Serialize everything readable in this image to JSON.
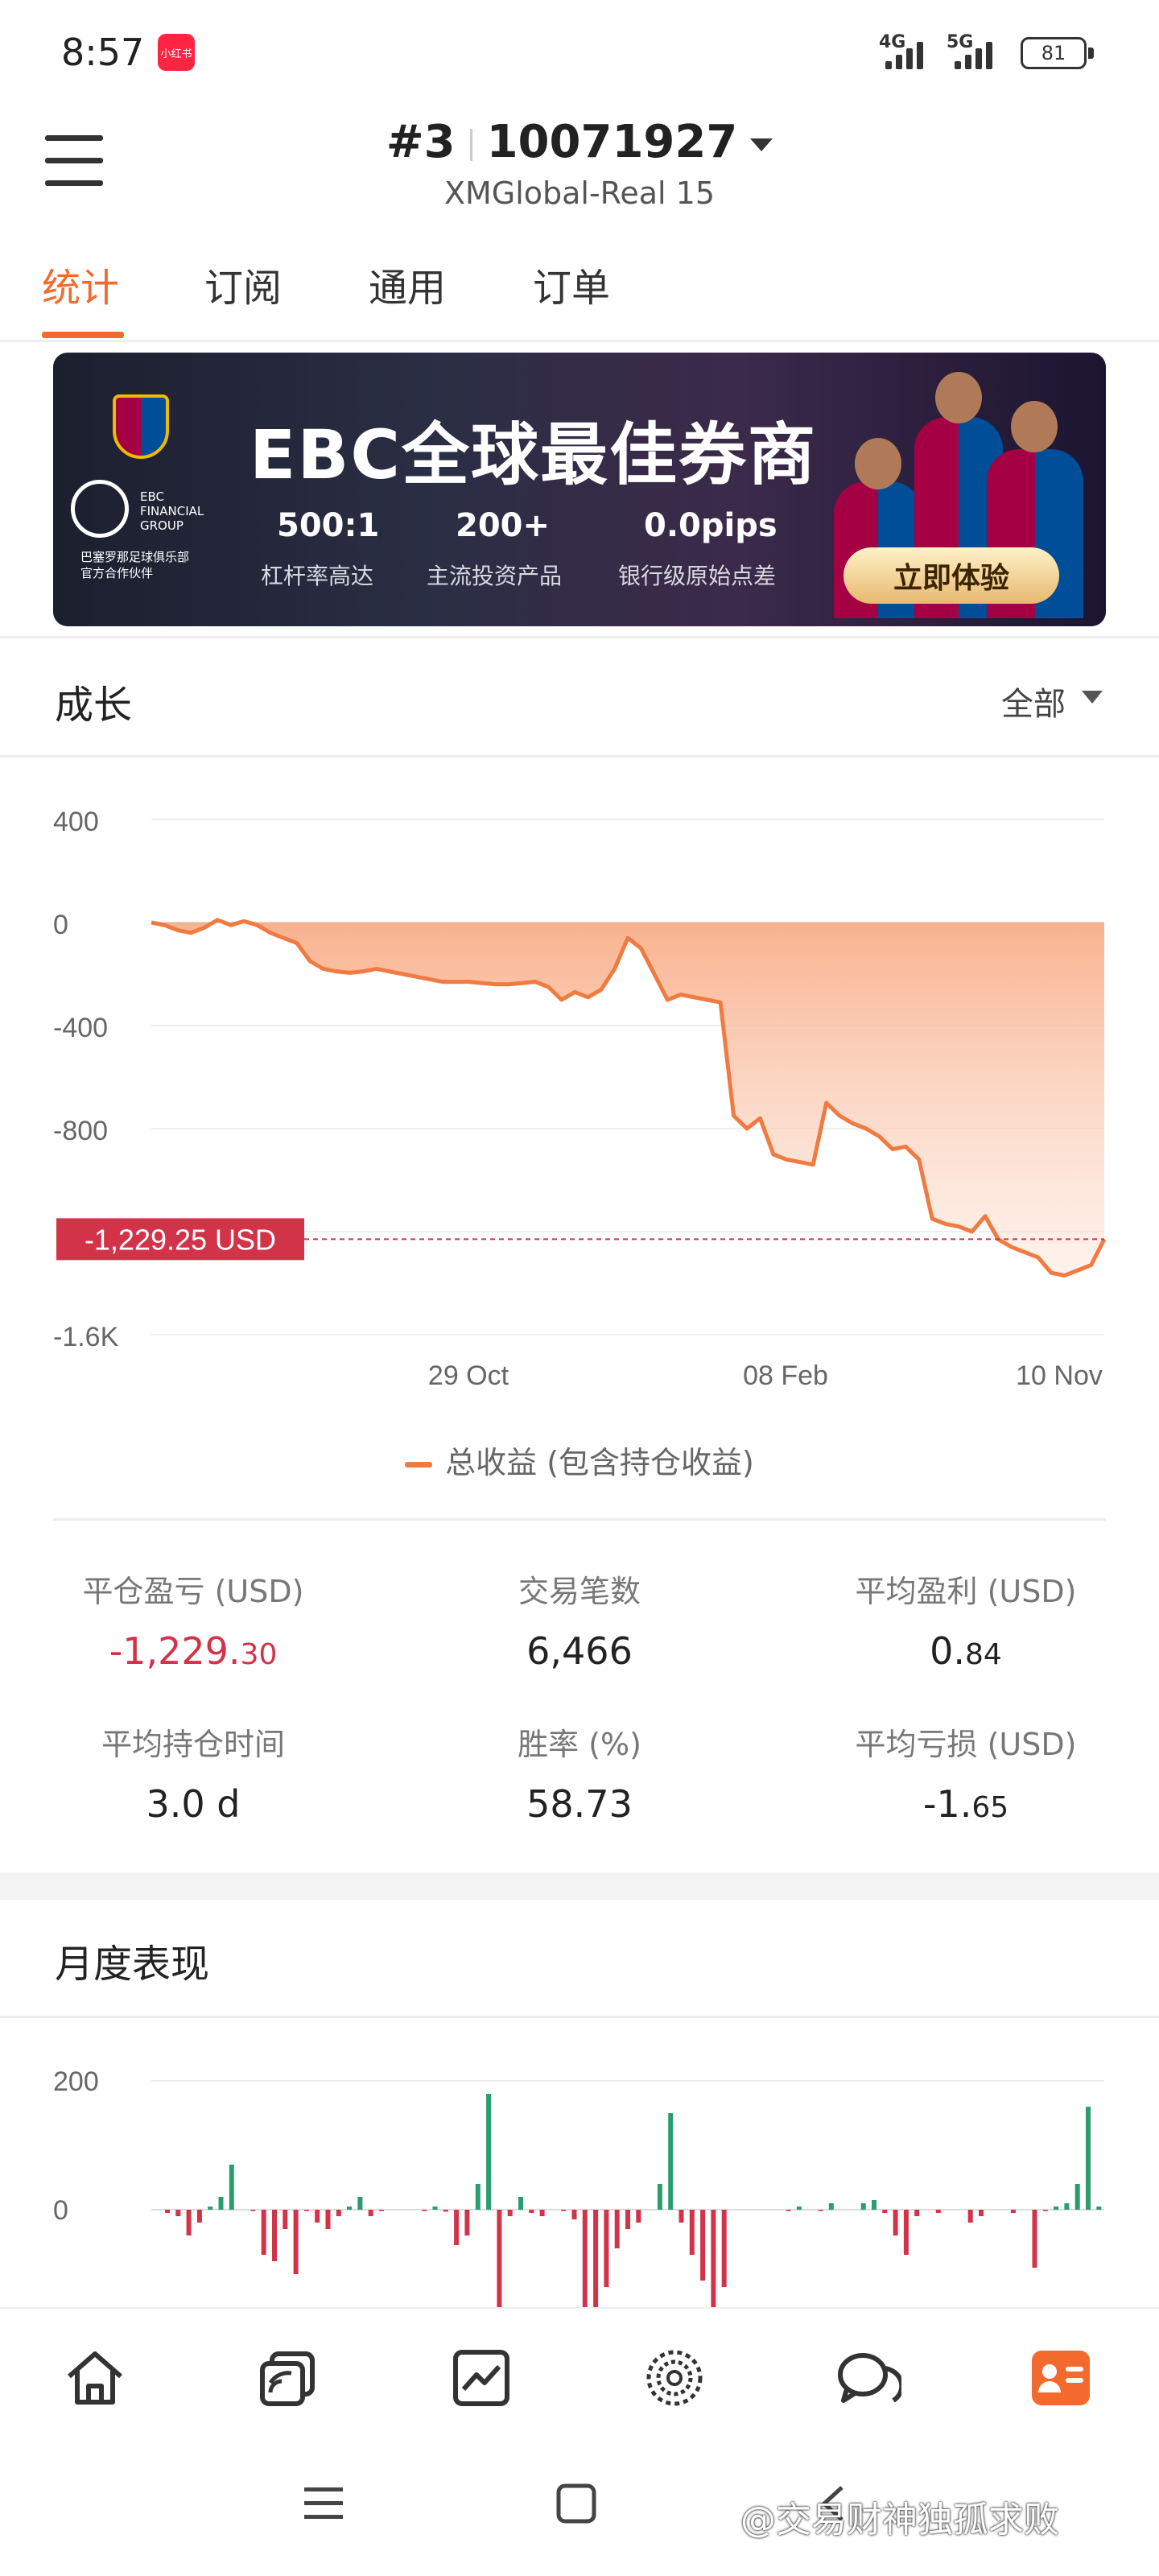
{
  "status_bar": {
    "time": "8:57",
    "app_badge": "小红书",
    "network1": "4G",
    "network2": "5G",
    "battery": "81"
  },
  "header": {
    "account_index": "#3",
    "account_number": "10071927",
    "server": "XMGlobal-Real 15"
  },
  "tabs": [
    {
      "label": "统计",
      "active": true
    },
    {
      "label": "订阅",
      "active": false
    },
    {
      "label": "通用",
      "active": false
    },
    {
      "label": "订单",
      "active": false
    }
  ],
  "banner": {
    "headline": "EBC全球最佳券商",
    "brand": "EBC FINANCIAL GROUP",
    "partner_line1": "巴塞罗那足球俱乐部",
    "partner_line2": "官方合作伙伴",
    "stats": [
      {
        "value": "500:1",
        "caption": "杠杆率高达"
      },
      {
        "value": "200+",
        "caption": "主流投资产品"
      },
      {
        "value": "0.0pips",
        "caption": "银行级原始点差"
      }
    ],
    "cta": "立即体验"
  },
  "growth": {
    "title": "成长",
    "filter": "全部",
    "current_value_label": "-1,229.25 USD",
    "legend": "总收益 (包含持仓收益)"
  },
  "chart_data": [
    {
      "type": "area",
      "title": "",
      "ylabel": "",
      "xlabel": "",
      "ylim": [
        -1600,
        400
      ],
      "yticks": [
        "400",
        "0",
        "-400",
        "-800",
        "-1.6K"
      ],
      "xticks": [
        "29 Oct",
        "08 Feb",
        "10 Nov"
      ],
      "current_value": -1229.25,
      "series": [
        {
          "name": "总收益 (包含持仓收益)",
          "color": "#f07a3f",
          "values": [
            0,
            -10,
            -30,
            -40,
            -20,
            10,
            -10,
            5,
            -10,
            -40,
            -60,
            -80,
            -150,
            -180,
            -190,
            -195,
            -190,
            -180,
            -190,
            -200,
            -210,
            -220,
            -230,
            -230,
            -230,
            -235,
            -240,
            -240,
            -235,
            -230,
            -250,
            -300,
            -270,
            -290,
            -260,
            -180,
            -60,
            -100,
            -200,
            -300,
            -280,
            -290,
            -300,
            -310,
            -750,
            -800,
            -760,
            -900,
            -920,
            -930,
            -940,
            -700,
            -750,
            -780,
            -800,
            -830,
            -880,
            -870,
            -920,
            -1150,
            -1170,
            -1180,
            -1200,
            -1140,
            -1230,
            -1260,
            -1280,
            -1300,
            -1360,
            -1370,
            -1350,
            -1330,
            -1229.25
          ]
        }
      ]
    },
    {
      "type": "bar",
      "title": "",
      "ylabel": "",
      "xlabel": "",
      "ylim": [
        -200,
        200
      ],
      "yticks": [
        "200",
        "0"
      ],
      "series": [
        {
          "name": "",
          "positive_color": "#2a9d6f",
          "negative_color": "#d33348",
          "values": [
            0,
            -5,
            -10,
            -40,
            -20,
            5,
            20,
            70,
            0,
            -2,
            -70,
            -80,
            -30,
            -100,
            -2,
            -20,
            -30,
            -10,
            5,
            20,
            -10,
            -2,
            0,
            0,
            0,
            -2,
            5,
            -3,
            -55,
            -40,
            40,
            180,
            -180,
            -10,
            20,
            -5,
            -10,
            0,
            -2,
            -15,
            -180,
            -160,
            -120,
            -60,
            -30,
            -20,
            0,
            40,
            150,
            -20,
            -70,
            -110,
            -180,
            -120,
            0,
            0,
            0,
            0,
            0,
            -2,
            5,
            0,
            -2,
            10,
            0,
            0,
            10,
            15,
            -5,
            -40,
            -70,
            -10,
            0,
            -5,
            0,
            0,
            -20,
            -10,
            0,
            0,
            -5,
            0,
            -90,
            -2,
            5,
            10,
            40,
            160,
            5
          ]
        }
      ]
    }
  ],
  "stats": {
    "closed_pnl_label": "平仓盈亏 (USD)",
    "closed_pnl_main": "-1,229.",
    "closed_pnl_cents": "30",
    "trades_label": "交易笔数",
    "trades_value": "6,466",
    "avg_profit_label": "平均盈利 (USD)",
    "avg_profit_main": "0.",
    "avg_profit_cents": "84",
    "avg_hold_label": "平均持仓时间",
    "avg_hold_value": "3.0 d",
    "win_rate_label": "胜率 (%)",
    "win_rate_value": "58.73",
    "avg_loss_label": "平均亏损 (USD)",
    "avg_loss_main": "-1.",
    "avg_loss_cents": "65"
  },
  "monthly": {
    "title": "月度表现"
  },
  "bottom_nav": {
    "items": [
      "home-icon",
      "copy-trade-icon",
      "chart-icon",
      "discover-icon",
      "chat-icon",
      "profile-icon"
    ],
    "active_color": "#f26a2e"
  },
  "watermark": "@交易财神独孤求败"
}
